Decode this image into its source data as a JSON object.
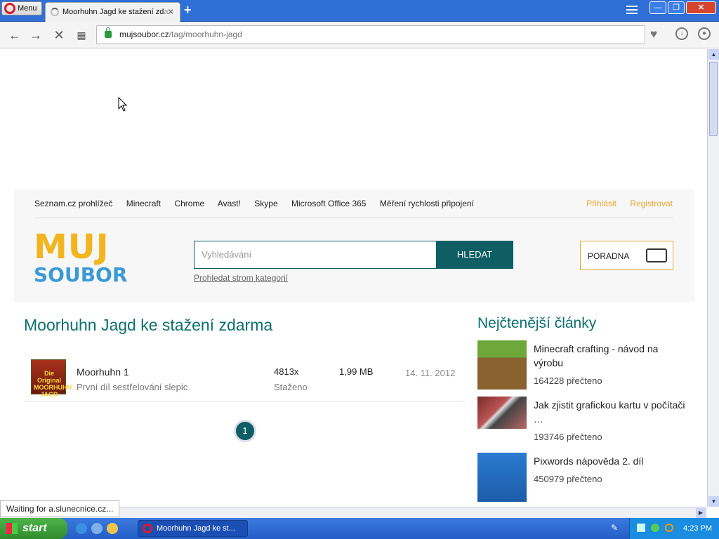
{
  "browser": {
    "menu_label": "Menu",
    "tab_title": "Moorhuhn Jagd ke stažení zd",
    "tab_title_fade": "a",
    "tab_close": "✕",
    "new_tab": "+",
    "url_domain": "mujsoubor.cz",
    "url_path": "/tag/moorhuhn-jagd",
    "win_min": "—",
    "win_max": "❐",
    "win_close": "✕",
    "status_tip": "Waiting for a.slunecnice.cz..."
  },
  "site": {
    "nav": [
      "Seznam.cz prohlížeč",
      "Minecraft",
      "Chrome",
      "Avast!",
      "Skype",
      "Microsoft Office 365",
      "Měření rychlosti připojení"
    ],
    "login": "Přihlásit",
    "register": "Registrovat",
    "logo_top": "MUJ",
    "logo_bottom": "SOUBOR",
    "search_placeholder": "Vyhledávání",
    "search_button": "HLEDAT",
    "category_link": "Prohledat strom kategorií",
    "poradna": "PORADNA",
    "main_title": "Moorhuhn Jagd ke stažení zdarma",
    "item": {
      "thumb_text": "Die Original MOORHUHN JAGD",
      "name": "Moorhuhn 1",
      "desc": "První díl sestřelování slepic",
      "count": "4813x",
      "count_label": "Staženo",
      "size": "1,99 MB",
      "date": "14. 11. 2012"
    },
    "page_current": "1",
    "side_title": "Nejčtenější články",
    "articles": [
      {
        "title": "Minecraft crafting - návod na výrobu",
        "reads": "164228 přečteno"
      },
      {
        "title": "Jak zjistit grafickou kartu v počítači …",
        "reads": "193746 přečteno"
      },
      {
        "title": "Pixwords nápověda 2. díl",
        "reads": "450979 přečteno"
      }
    ]
  },
  "taskbar": {
    "start": "start",
    "task_item": "Moorhuhn Jagd ke st...",
    "clock": "4:23 PM"
  }
}
